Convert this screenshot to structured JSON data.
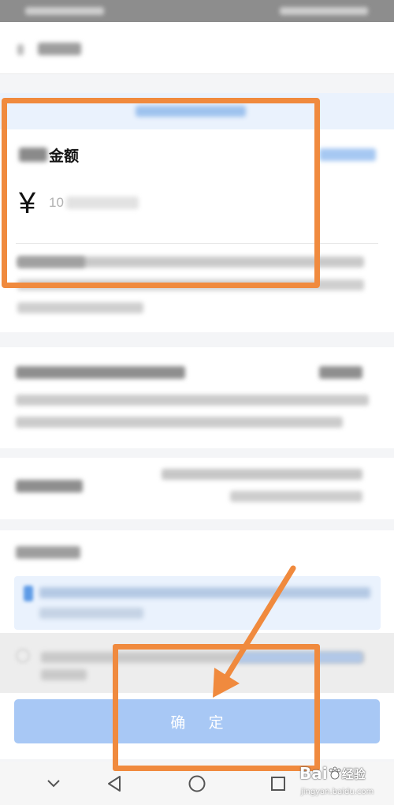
{
  "amount_section": {
    "label": "金额",
    "currency_symbol": "¥",
    "amount_prefix": "10"
  },
  "confirm_button": {
    "label": "确 定",
    "color": "#a8c8f5"
  },
  "nav": {
    "back_icon": "chevron-down-icon",
    "triangle_icon": "back-triangle-icon",
    "home_icon": "home-circle-icon",
    "recent_icon": "recent-square-icon"
  },
  "watermark": {
    "logo_text": "Bai",
    "logo_suffix": "经验",
    "url": "jingyan.baidu.com"
  },
  "colors": {
    "annotation": "#f08a3e",
    "accent_blue": "#5e9be6",
    "notice_bg": "#eaf2fd"
  }
}
